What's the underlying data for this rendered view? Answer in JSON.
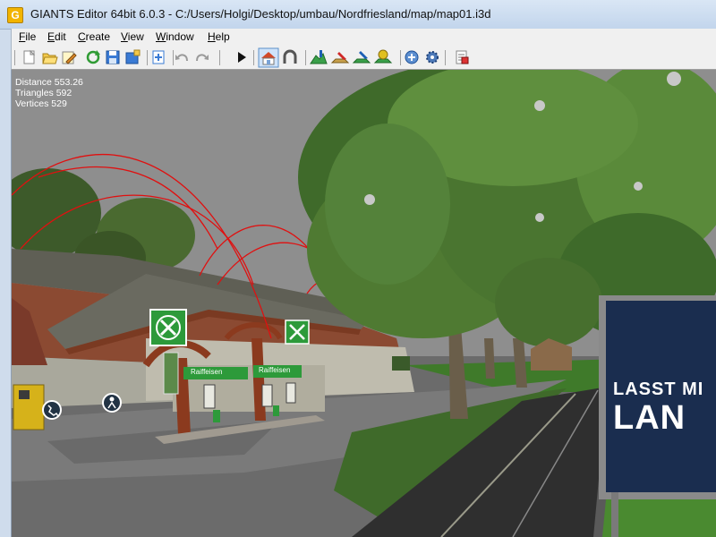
{
  "window": {
    "title": "GIANTS Editor 64bit 6.0.3 - C:/Users/Holgi/Desktop/umbau/Nordfriesland/map/map01.i3d",
    "app_icon_letter": "G"
  },
  "menu": [
    "File",
    "Edit",
    "Create",
    "View",
    "Window",
    "Help"
  ],
  "toolbar": {
    "groups": [
      [
        "new-file-icon",
        "open-folder-icon",
        "edit-pencil-icon",
        "reload-icon",
        "save-icon",
        "save-as-icon"
      ],
      [
        "import-icon"
      ],
      [
        "undo-icon",
        "redo-icon"
      ],
      [
        "play-icon"
      ],
      [
        "camera-home-icon",
        "snap-magnet-icon"
      ],
      [
        "terrain-sculpt-icon",
        "terrain-paint-icon",
        "foliage-paint-icon",
        "tree-paint-icon"
      ],
      [
        "scripts-icon",
        "settings-gear-icon"
      ],
      [
        "log-icon"
      ]
    ],
    "active": "camera-home-icon"
  },
  "viewport": {
    "stats": {
      "distance": "Distance 553.26",
      "triangles": "Triangles 592",
      "vertices": "Vertices 529"
    },
    "billboard": {
      "line1": "LASST MI",
      "line2": "LAN"
    },
    "station_signs": [
      "Raiffeisen",
      "Raiffeisen"
    ],
    "colors": {
      "sky": "#8e8e8e",
      "grass": "#3f7a2a",
      "billboard": "#1a2d4f",
      "accent": "#2d9a3a",
      "wire": "#e01010"
    }
  }
}
